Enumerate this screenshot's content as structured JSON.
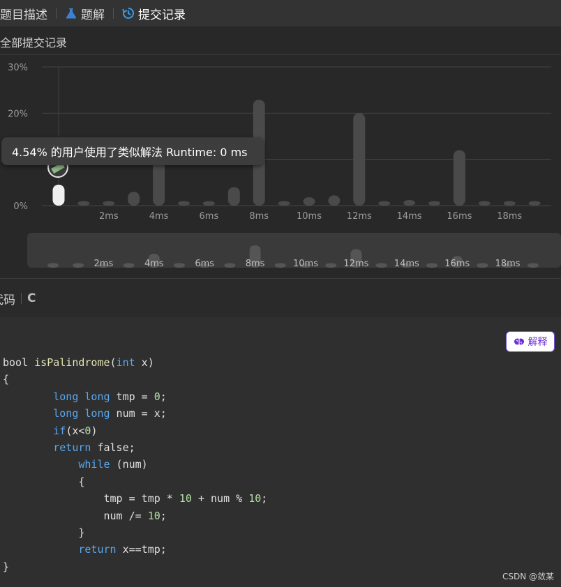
{
  "tabs": [
    {
      "label": "题目描述",
      "icon": "description-icon"
    },
    {
      "label": "题解",
      "icon": "flask-icon"
    },
    {
      "label": "提交记录",
      "icon": "history-icon"
    }
  ],
  "section_title": "全部提交记录",
  "tooltip_text": "4.54% 的用户使用了类似解法 Runtime: 0 ms",
  "lang_label": "代码",
  "lang_value": "C",
  "explain_label": "解释",
  "watermark": "CSDN @敛某",
  "colors": {
    "accent": "#5aa6ef",
    "tab_active": "#ffffff",
    "bar": "#4a4a4a",
    "highlight_bar": "#f0f0f0",
    "explain": "#6a2fd6"
  },
  "chart_data": {
    "type": "bar",
    "ylim": [
      0,
      30
    ],
    "yticks": [
      "30%",
      "20%",
      "0%"
    ],
    "yticks_values": [
      30,
      20,
      0
    ],
    "xtick_labels": [
      "2ms",
      "4ms",
      "6ms",
      "8ms",
      "10ms",
      "12ms",
      "14ms",
      "16ms",
      "18ms"
    ],
    "xtick_values": [
      2,
      4,
      6,
      8,
      10,
      12,
      14,
      16,
      18
    ],
    "x": [
      0,
      1,
      2,
      3,
      4,
      5,
      6,
      7,
      8,
      9,
      10,
      11,
      12,
      13,
      14,
      15,
      16,
      17,
      18,
      19
    ],
    "values": [
      4.54,
      1.0,
      1.0,
      3.0,
      10.0,
      1.0,
      1.0,
      4.0,
      22.9,
      1.0,
      1.8,
      2.2,
      20.0,
      1.0,
      1.2,
      1.0,
      12.0,
      1.0,
      1.0,
      1.0
    ],
    "highlight_index": 0,
    "grid": true,
    "overview_values": [
      1.0,
      1.0,
      1.0,
      1.0,
      3.0,
      1.0,
      1.0,
      1.0,
      4.8,
      1.0,
      1.0,
      1.0,
      4.0,
      1.0,
      1.0,
      1.0,
      2.5,
      1.0,
      1.0,
      1.0
    ]
  },
  "code_lines": [
    [
      [
        "kw2",
        "bool "
      ],
      [
        "fn",
        "isPalindrome"
      ],
      [
        "p",
        "("
      ],
      [
        "kw",
        "int"
      ],
      [
        "p",
        " x)"
      ]
    ],
    [
      [
        "p",
        "{"
      ]
    ],
    [
      [
        "p",
        "        "
      ],
      [
        "kw",
        "long"
      ],
      [
        "p",
        " "
      ],
      [
        "kw",
        "long"
      ],
      [
        "p",
        " tmp = "
      ],
      [
        "num",
        "0"
      ],
      [
        "p",
        ";"
      ]
    ],
    [
      [
        "p",
        "        "
      ],
      [
        "kw",
        "long"
      ],
      [
        "p",
        " "
      ],
      [
        "kw",
        "long"
      ],
      [
        "p",
        " num = x;"
      ]
    ],
    [
      [
        "p",
        "        "
      ],
      [
        "kw",
        "if"
      ],
      [
        "p",
        "(x<"
      ],
      [
        "num",
        "0"
      ],
      [
        "p",
        ")"
      ]
    ],
    [
      [
        "p",
        "        "
      ],
      [
        "kw",
        "return"
      ],
      [
        "p",
        " false;"
      ]
    ],
    [
      [
        "p",
        "            "
      ],
      [
        "kw",
        "while"
      ],
      [
        "p",
        " (num)"
      ]
    ],
    [
      [
        "p",
        "            {"
      ]
    ],
    [
      [
        "p",
        "                tmp = tmp * "
      ],
      [
        "num",
        "10"
      ],
      [
        "p",
        " + num % "
      ],
      [
        "num",
        "10"
      ],
      [
        "p",
        ";"
      ]
    ],
    [
      [
        "p",
        "                num /= "
      ],
      [
        "num",
        "10"
      ],
      [
        "p",
        ";"
      ]
    ],
    [
      [
        "p",
        "            }"
      ]
    ],
    [
      [
        "p",
        "            "
      ],
      [
        "kw",
        "return"
      ],
      [
        "p",
        " x==tmp;"
      ]
    ],
    [
      [
        "p",
        "}"
      ]
    ]
  ]
}
